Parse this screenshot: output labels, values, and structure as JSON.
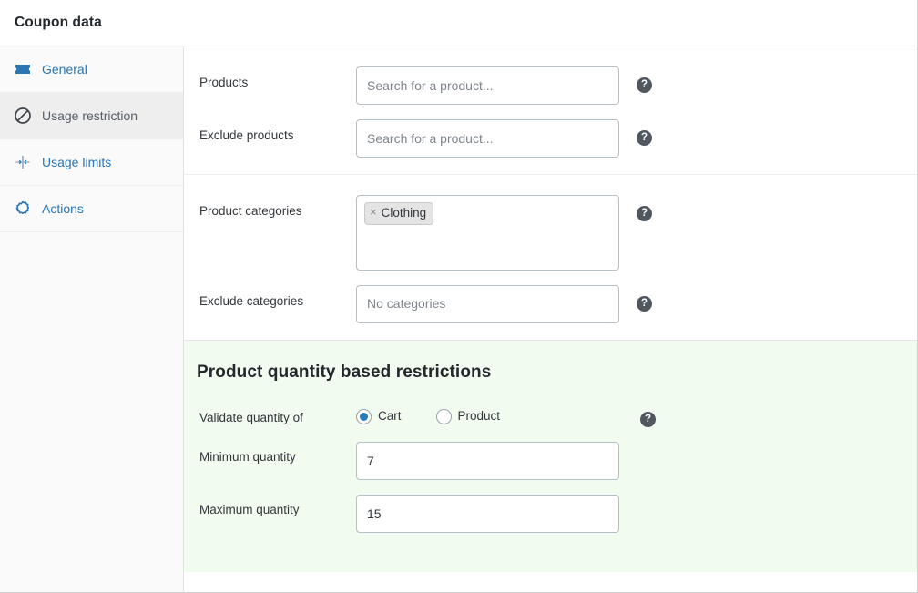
{
  "header": {
    "title": "Coupon data"
  },
  "sidebar": {
    "items": [
      {
        "label": "General",
        "icon": "ticket-icon",
        "active": false
      },
      {
        "label": "Usage restriction",
        "icon": "no-entry-icon",
        "active": true
      },
      {
        "label": "Usage limits",
        "icon": "usage-limits-icon",
        "active": false
      },
      {
        "label": "Actions",
        "icon": "gear-icon",
        "active": false
      }
    ]
  },
  "main": {
    "group_products": {
      "products": {
        "label": "Products",
        "placeholder": "Search for a product...",
        "value": "",
        "help": "?"
      },
      "exclude_products": {
        "label": "Exclude products",
        "placeholder": "Search for a product...",
        "value": "",
        "help": "?"
      }
    },
    "group_categories": {
      "product_categories": {
        "label": "Product categories",
        "help": "?",
        "tags": [
          {
            "remove": "×",
            "label": "Clothing"
          }
        ]
      },
      "exclude_categories": {
        "label": "Exclude categories",
        "placeholder": "No categories",
        "help": "?",
        "tags": []
      }
    },
    "quantity_section": {
      "title": "Product quantity based restrictions",
      "validate_quantity": {
        "label": "Validate quantity of",
        "help": "?",
        "options": [
          {
            "label": "Cart",
            "checked": true
          },
          {
            "label": "Product",
            "checked": false
          }
        ]
      },
      "minimum_quantity": {
        "label": "Minimum quantity",
        "value": "7",
        "placeholder": ""
      },
      "maximum_quantity": {
        "label": "Maximum quantity",
        "value": "15",
        "placeholder": ""
      }
    }
  },
  "colors": {
    "link": "#2a75b3",
    "active_bg": "#eeeeee",
    "section_green": "#f1fbf0",
    "radio_accent": "#2a7ac0",
    "help_bg": "#50575e"
  }
}
